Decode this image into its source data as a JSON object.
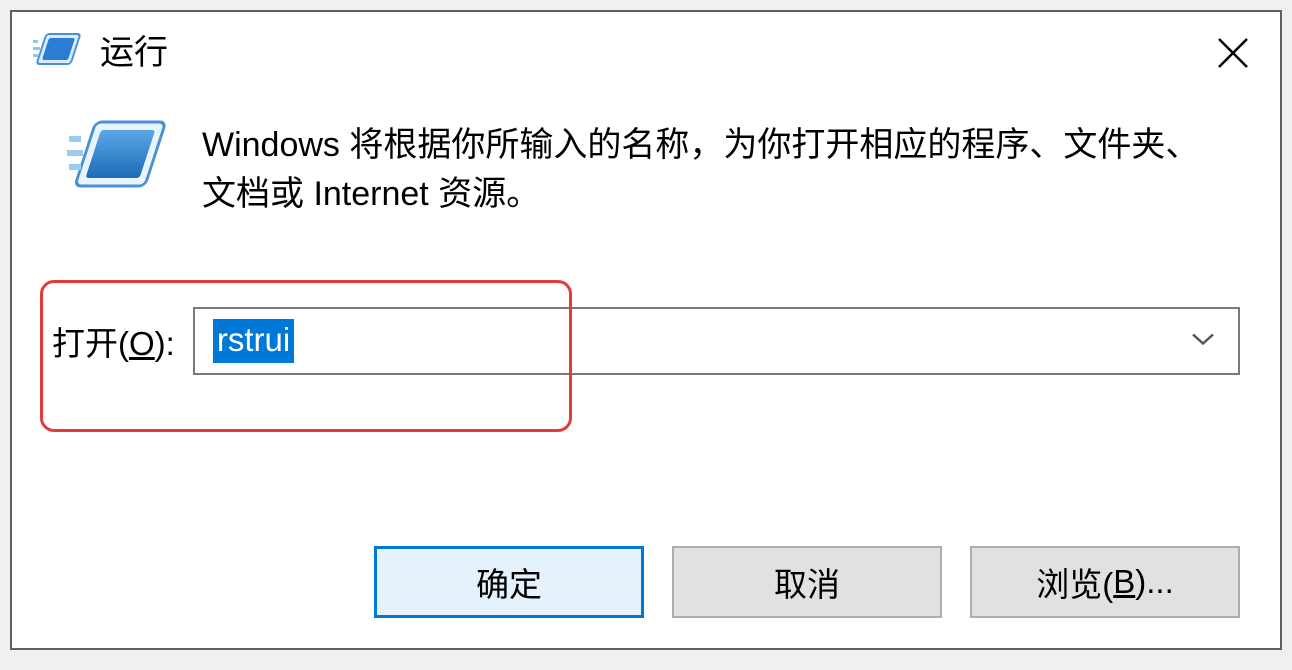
{
  "dialog": {
    "title": "运行",
    "description": "Windows 将根据你所输入的名称，为你打开相应的程序、文件夹、文档或 Internet 资源。",
    "input_label_prefix": "打开(",
    "input_label_hotkey": "O",
    "input_label_suffix": "):",
    "input_value": "rstrui",
    "buttons": {
      "ok": "确定",
      "cancel": "取消",
      "browse_prefix": "浏览(",
      "browse_hotkey": "B",
      "browse_suffix": ")..."
    }
  }
}
